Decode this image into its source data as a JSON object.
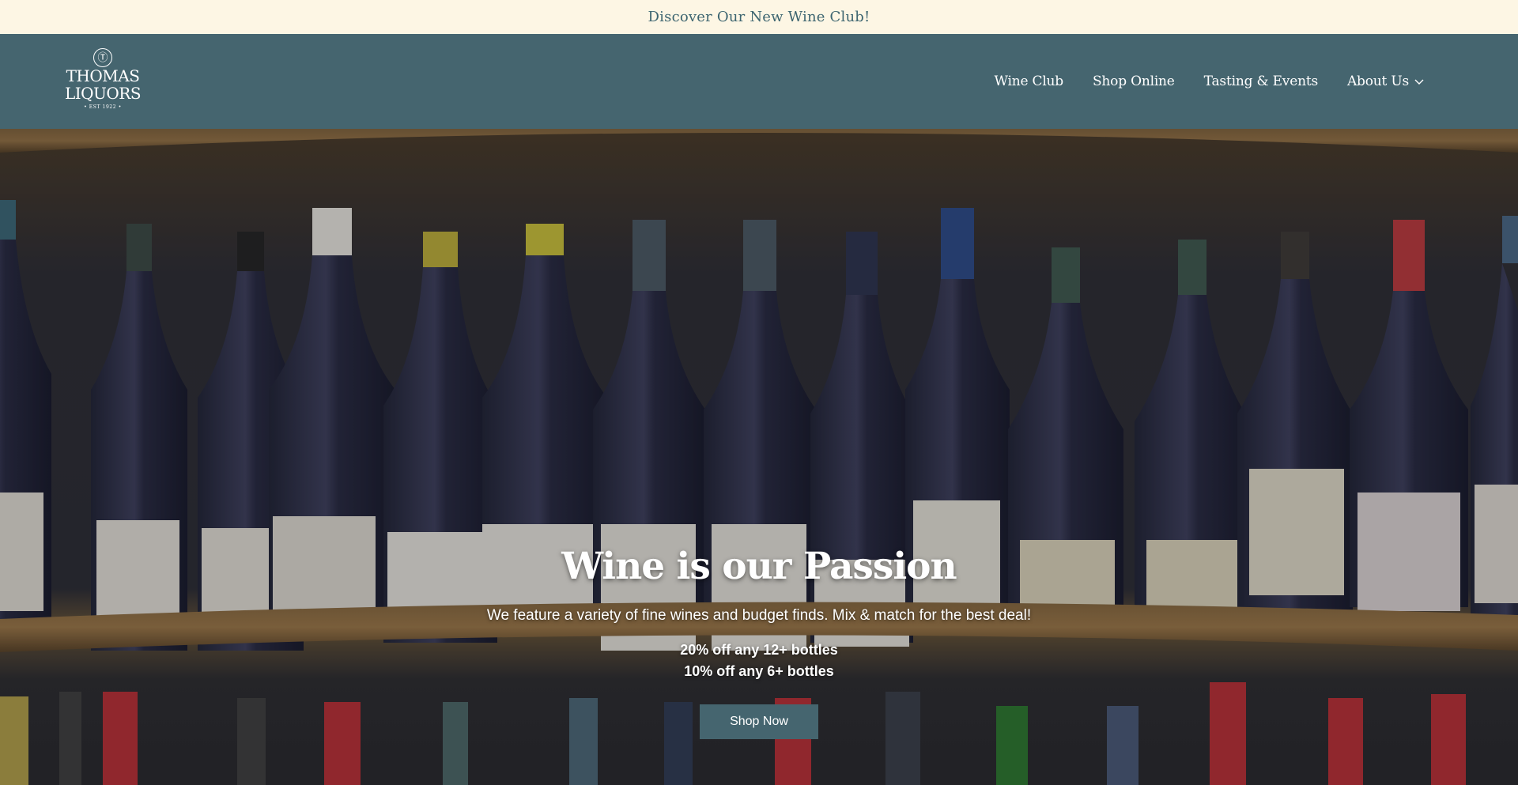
{
  "announcement": {
    "text": "Discover Our New Wine Club!"
  },
  "header": {
    "logo": {
      "mark": "Ⓣ",
      "line1": "THOMAS",
      "line2": "LIQUORS",
      "est": "• EST 1922 •"
    },
    "nav": [
      {
        "label": "Wine Club"
      },
      {
        "label": "Shop Online"
      },
      {
        "label": "Tasting & Events"
      },
      {
        "label": "About Us",
        "icon": "chevron-down-icon"
      }
    ]
  },
  "hero": {
    "title": "Wine is our Passion",
    "subtitle": "We feature a variety of fine wines and budget finds. Mix & match for the best deal!",
    "offers": [
      "20% off any 12+ bottles",
      "10% off any 6+ bottles"
    ],
    "cta": "Shop Now"
  },
  "colors": {
    "announcement_bg": "#fdf6e4",
    "announcement_text": "#3d6570",
    "nav_bg": "#45656f",
    "button_bg": "#45656f"
  }
}
